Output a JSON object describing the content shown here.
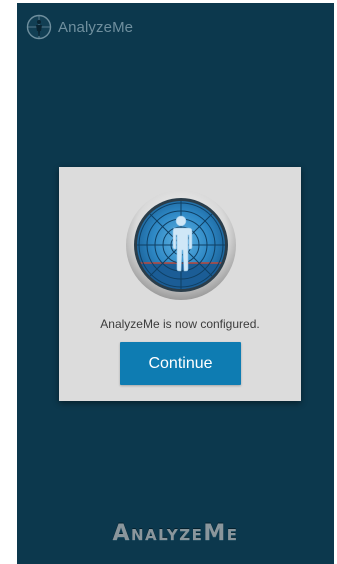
{
  "app": {
    "title": "AnalyzeMe"
  },
  "dialog": {
    "message": "AnalyzeMe is now configured.",
    "continue_label": "Continue"
  },
  "footer": {
    "logo_text": "AnalyzeMe"
  },
  "icons": {
    "app_icon": "analyzeme-app-icon",
    "dialog_logo": "body-scan-radar-icon"
  },
  "colors": {
    "background": "#0c384d",
    "dialog": "#dcdcdc",
    "accent": "#0e7cb2"
  }
}
